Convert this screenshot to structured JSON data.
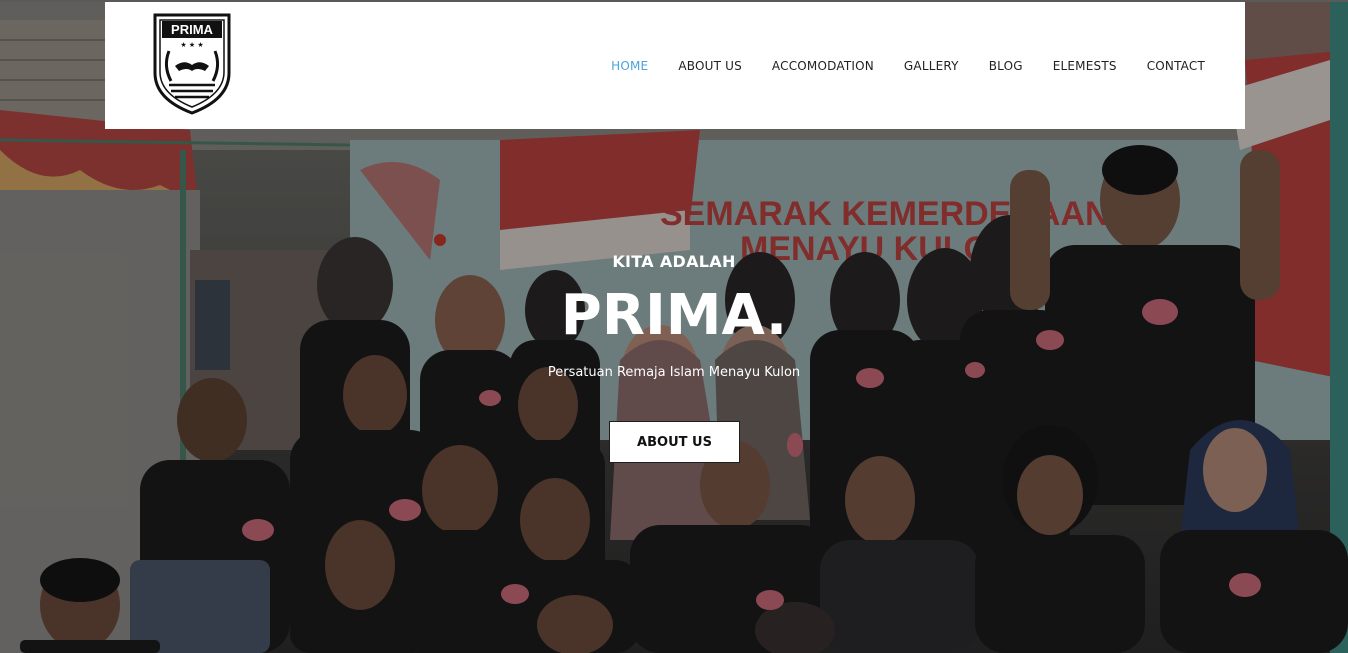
{
  "brand": {
    "logo_text": "PRIMA",
    "logo_icon": "handshake-shield-icon"
  },
  "nav": {
    "items": [
      {
        "label": "HOME",
        "active": true
      },
      {
        "label": "ABOUT US",
        "active": false
      },
      {
        "label": "ACCOMODATION",
        "active": false
      },
      {
        "label": "GALLERY",
        "active": false
      },
      {
        "label": "BLOG",
        "active": false
      },
      {
        "label": "ELEMESTS",
        "active": false
      },
      {
        "label": "CONTACT",
        "active": false
      }
    ],
    "active_color": "#4aa3df",
    "text_color": "#222222"
  },
  "hero": {
    "kicker": "KITA ADALAH",
    "title": "PRIMA.",
    "subtitle": "Persatuan Remaja Islam Menayu Kulon",
    "button_label": "ABOUT US",
    "banner_text_line1": "SEMARAK KEMERDEKAAN",
    "banner_text_line2": "MENAYU KULON"
  },
  "colors": {
    "banner_red": "#c0392b",
    "header_bg": "#ffffff"
  }
}
